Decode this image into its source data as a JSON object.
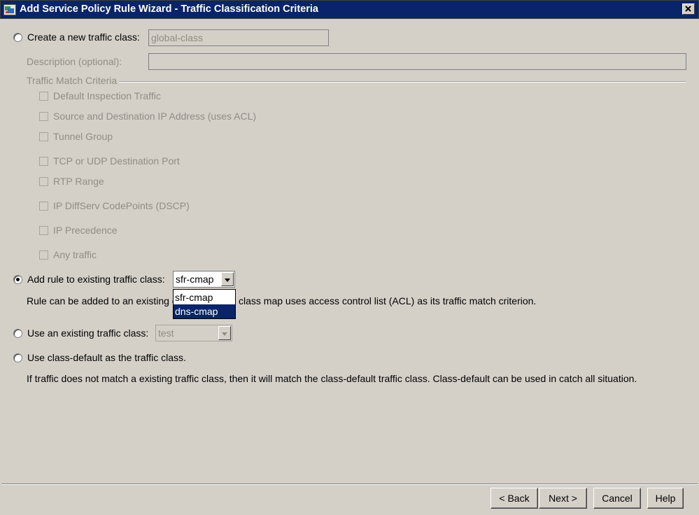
{
  "window": {
    "title": "Add Service Policy Rule Wizard - Traffic Classification Criteria",
    "close_glyph": "×"
  },
  "options": {
    "create_new": {
      "label": "Create a new traffic class:",
      "value": "global-class",
      "selected": false
    },
    "description": {
      "label": "Description (optional):",
      "value": ""
    },
    "criteria_group": {
      "label": "Traffic Match Criteria",
      "items": [
        "Default Inspection Traffic",
        "Source and Destination IP Address (uses ACL)",
        "Tunnel Group",
        "TCP or UDP Destination Port",
        "RTP Range",
        "IP DiffServ CodePoints (DSCP)",
        "IP Precedence",
        "Any traffic"
      ]
    },
    "add_rule": {
      "label": "Add rule to existing traffic class:",
      "selected": true,
      "combo_value": "sfr-cmap",
      "dropdown_options": [
        "sfr-cmap",
        "dns-cmap"
      ],
      "highlighted_option": "dns-cmap",
      "note_left": "Rule can be added to an existing cl",
      "note_right": "class map uses access control list (ACL) as its traffic match criterion."
    },
    "use_existing": {
      "label": "Use an existing traffic class:",
      "combo_value": "test",
      "selected": false
    },
    "class_default": {
      "label": "Use class-default as the traffic class.",
      "selected": false,
      "note": "If traffic does not match a existing traffic class, then it will match the class-default traffic class. Class-default can be used in catch all situation."
    }
  },
  "buttons": {
    "back": "< Back",
    "next": "Next >",
    "cancel": "Cancel",
    "help": "Help"
  },
  "colors": {
    "titlebar": "#0a246a",
    "dialog_bg": "#d4d0c8",
    "disabled_text": "#8f8d86",
    "selection": "#0a246a"
  }
}
